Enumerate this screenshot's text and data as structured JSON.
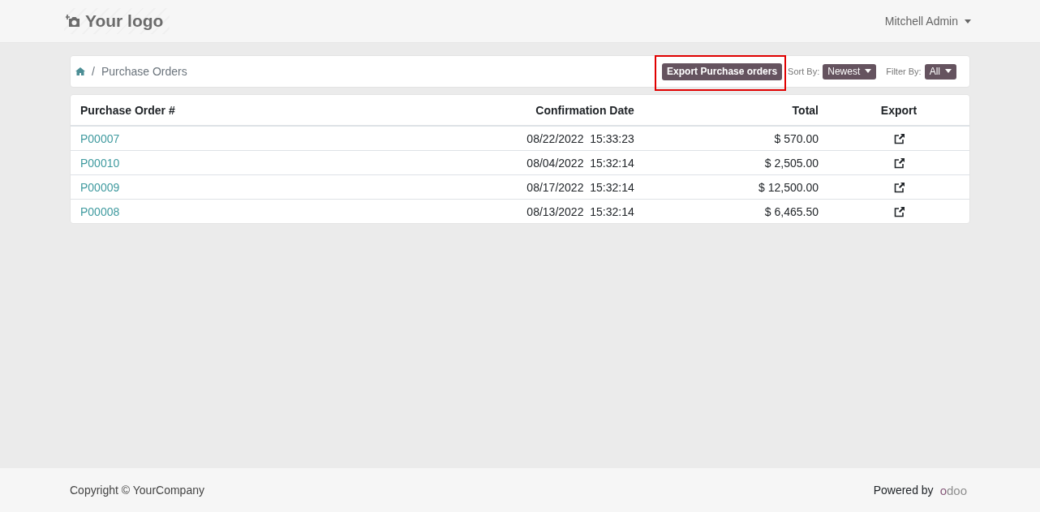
{
  "header": {
    "logo": "Your logo",
    "user": "Mitchell Admin"
  },
  "breadcrumb": {
    "separator": "/",
    "items": [
      "Purchase Orders"
    ],
    "export_button": {
      "label": "Export Purchase orders",
      "highlighted": true
    },
    "sort": {
      "label": "Sort By:",
      "value": "Newest"
    },
    "filter": {
      "label": "Filter By:",
      "value": "All"
    }
  },
  "table": {
    "columns": [
      "Purchase Order #",
      "Confirmation Date",
      "Total",
      "Export"
    ],
    "rows": [
      {
        "order": "P00007",
        "date": "08/22/2022  15:33:23",
        "total": "$ 570.00"
      },
      {
        "order": "P00010",
        "date": "08/04/2022  15:32:14",
        "total": "$ 2,505.00"
      },
      {
        "order": "P00009",
        "date": "08/17/2022  15:32:14",
        "total": "$ 12,500.00"
      },
      {
        "order": "P00008",
        "date": "08/13/2022  15:32:14",
        "total": "$ 6,465.50"
      }
    ]
  },
  "footer": {
    "copyright": "Copyright © YourCompany",
    "powered_by": "Powered by",
    "brand": "odoo"
  }
}
